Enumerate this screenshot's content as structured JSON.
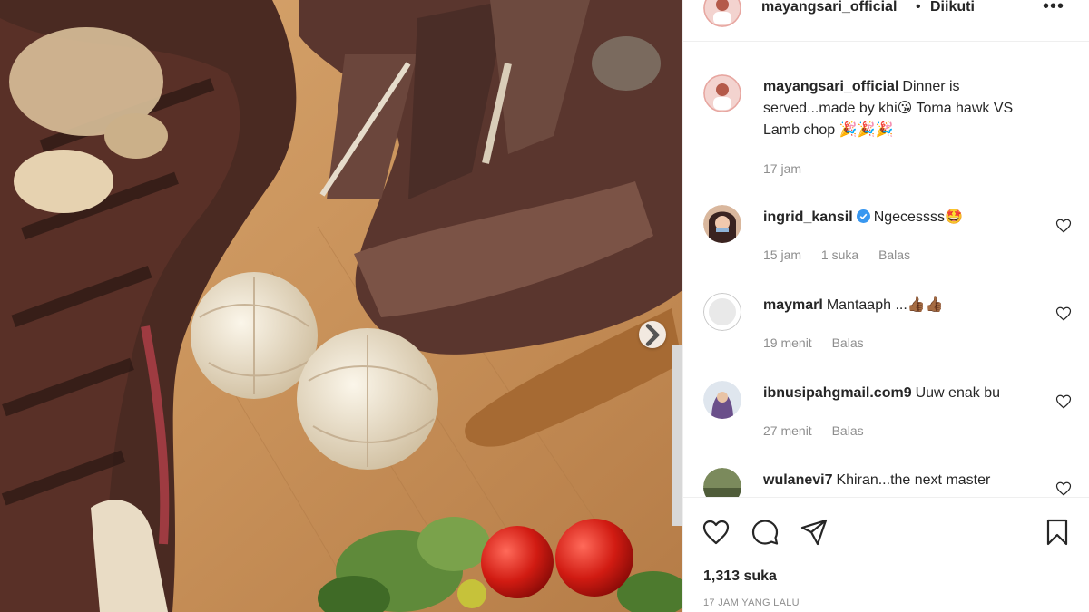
{
  "post": {
    "username": "mayangsari_official",
    "separator": "•",
    "follow_status": "Diikuti",
    "more": "•••"
  },
  "caption": {
    "username": "mayangsari_official",
    "text": "Dinner is served...made by khi😘 Toma hawk VS Lamb chop 🎉🎉🎉",
    "time": "17 jam"
  },
  "comments": [
    {
      "username": "ingrid_kansil",
      "verified": true,
      "text": "Ngecessss🤩",
      "time": "15 jam",
      "likes": "1 suka",
      "reply": "Balas"
    },
    {
      "username": "maymarl",
      "verified": false,
      "text": "Mantaaph ...👍🏾👍🏾",
      "time": "19 menit",
      "reply": "Balas"
    },
    {
      "username": "ibnusipahgmail.com9",
      "verified": false,
      "text": "Uuw enak bu",
      "time": "27 menit",
      "reply": "Balas"
    },
    {
      "username": "wulanevi7",
      "verified": false,
      "text": "Khiran...the next master"
    }
  ],
  "footer": {
    "likes": "1,313 suka",
    "time_ago": "17 JAM YANG LALU"
  },
  "icons": {
    "like": "heart-icon",
    "comment": "comment-icon",
    "share": "paper-plane-icon",
    "save": "bookmark-icon",
    "next": "chevron-right-icon"
  },
  "colors": {
    "text": "#262626",
    "muted": "#8e8e8e",
    "verified": "#3897f0",
    "divider": "#efefef"
  }
}
